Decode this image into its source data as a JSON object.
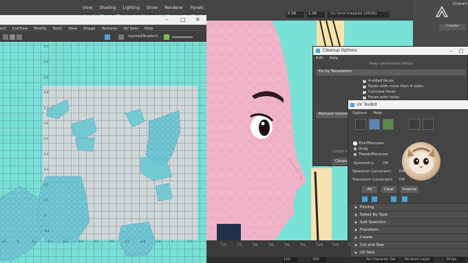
{
  "maya_menu": [
    "View",
    "Shading",
    "Lighting",
    "Show",
    "Renderer",
    "Panels"
  ],
  "maya_fields": {
    "exposure": "0.00",
    "gamma": "1.00",
    "color_space": "Un-tone-mapped (sRGB)"
  },
  "right_panel": {
    "title": "Charact",
    "create": "Create"
  },
  "uv_editor": {
    "title_buttons": [
      "–",
      "□",
      "✕"
    ],
    "menu": [
      "ect",
      "Cut/Sew",
      "Modify",
      "Tools",
      "View",
      "Image",
      "Textures",
      "UV Sets",
      "Help"
    ],
    "shader": "layeredShader2",
    "v_ticks": [
      "0.2",
      "0.1",
      "0.9",
      "0.8",
      "0.7",
      "0.6",
      "0.5",
      "0.4",
      "0.3",
      "0.2",
      "0.1",
      "0",
      "-0.1"
    ],
    "u_ticks": [
      "-0.1",
      "0",
      "0.1",
      "0.2",
      "0.3",
      "0.4",
      "0.5",
      "0.6",
      "0.7",
      "0.8",
      "0.9",
      "1",
      "1.1"
    ]
  },
  "cleanup": {
    "title": "Cleanup Options",
    "menu": [
      "Edit",
      "Help"
    ],
    "top_line": "Keep construction history",
    "section": "Fix by Tesselation",
    "checks": [
      "4-sided faces",
      "Faces with more than 4 sides",
      "Concave faces",
      "Faces with holes"
    ],
    "remove": "Remove Geometry",
    "length_tol": "Length to",
    "button": "Cleanup"
  },
  "uv_toolkit": {
    "title": "UV Toolkit",
    "menu": [
      "Options",
      "Help"
    ],
    "modes": [
      "Pick/Marquee",
      "Drag",
      "Tweak/Marquee"
    ],
    "symmetry_label": "Symmetry:",
    "symmetry_value": "Off",
    "sel_label": "Selection Constraint:",
    "sel_value": "Off",
    "trans_label": "Transform Constraint:",
    "trans_value": "Off",
    "buttons": [
      "All",
      "Clear",
      "Inverse"
    ],
    "sections": [
      "Pinning",
      "Select By Type",
      "Soft Selection",
      "Transform",
      "Create",
      "Cut and Sew",
      "UV Sets"
    ]
  },
  "timeline": {
    "ticks": [
      "70",
      "75",
      "80",
      "85",
      "90",
      "95",
      "100",
      "105",
      "110"
    ]
  },
  "bottom": {
    "start": "120",
    "end": "200",
    "charset": "No Character Set",
    "anim": "No Anim Layer",
    "fps": "24 fps"
  },
  "colors": {
    "uv_bg": "#78dfd6",
    "viewport_bg": "#79e2d7",
    "skin": "#f2b4c8",
    "accent": "#5a86b5"
  }
}
